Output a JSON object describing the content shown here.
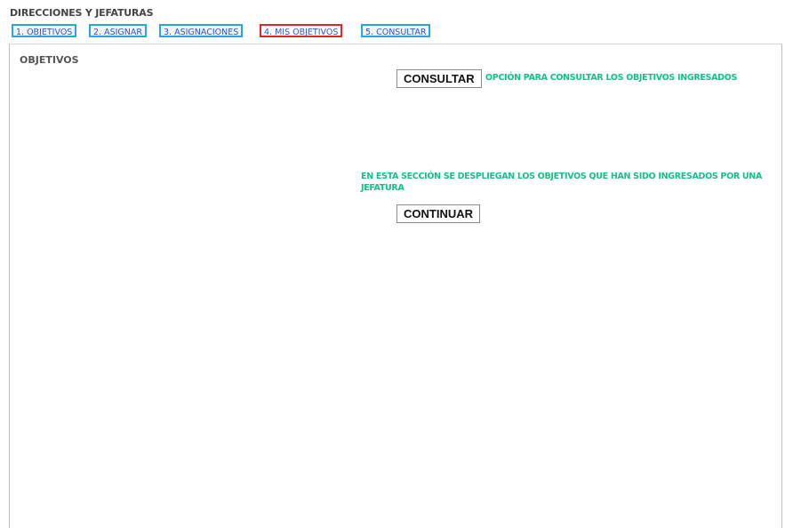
{
  "header": {
    "title": "DIRECCIONES Y JEFATURAS"
  },
  "tabs": [
    {
      "label": "1. OBJETIVOS",
      "active": false
    },
    {
      "label": "2. ASIGNAR",
      "active": false
    },
    {
      "label": "3. ASIGNACIONES",
      "active": false
    },
    {
      "label": "4. MIS OBJETIVOS",
      "active": true
    },
    {
      "label": "5. CONSULTAR",
      "active": false
    }
  ],
  "panel": {
    "title": "OBJETIVOS",
    "consultar_button": "CONSULTAR",
    "consultar_note": "OPCIÓN PARA CONSULTAR LOS OBJETIVOS INGRESADOS",
    "section_note": "EN ESTA SECCIÓN SE DESPLIEGAN LOS OBJETIVOS QUE HAN SIDO INGRESADOS POR UNA JEFATURA",
    "continuar_button": "CONTINUAR"
  },
  "colors": {
    "tab_border": "#2aa6df",
    "tab_active_border": "#e8232b",
    "tab_text": "#2a5bc4",
    "note_text": "#14c08a"
  }
}
